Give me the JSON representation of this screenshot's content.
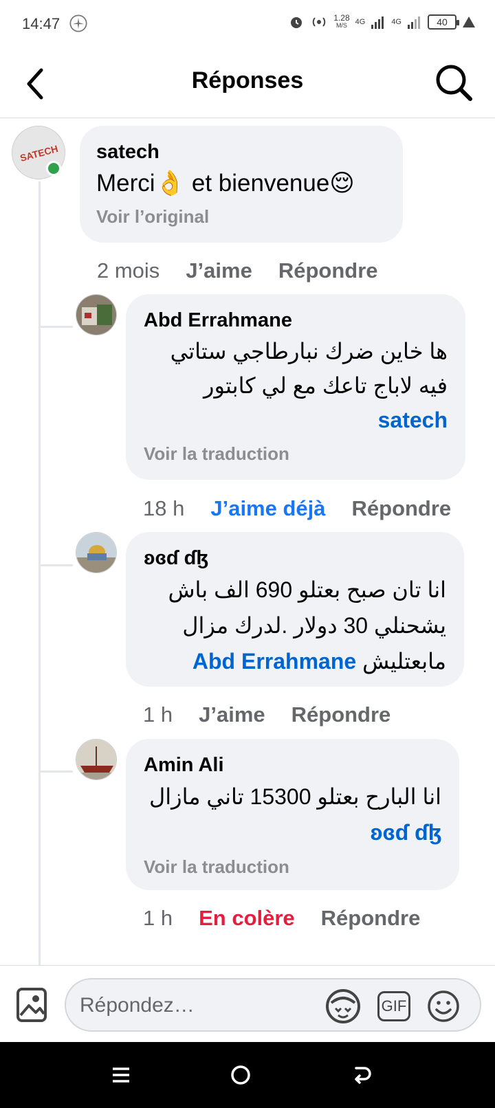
{
  "status_bar": {
    "time": "14:47",
    "speed_value": "1.28",
    "speed_unit": "M/S",
    "net1": "4G",
    "net2": "4G",
    "battery": "40"
  },
  "header": {
    "title": "Réponses"
  },
  "comments": [
    {
      "author": "satech",
      "text": "Merci👌 et bienvenue😌",
      "sub_link": "Voir l’original",
      "time": "2 mois",
      "like_label": "J’aime",
      "reply_label": "Répondre"
    },
    {
      "author": "Abd Errahmane",
      "mention": "satech",
      "text": "ها خاين ضرك نبارطاجي ستاتي فيه لاباج تاعك مع لي كابتور",
      "sub_link": "Voir la traduction",
      "time": "18 h",
      "like_label": "J’aime déjà",
      "reply_label": "Répondre"
    },
    {
      "author": "ʚɞɗ ɗɮ",
      "mention": "Abd Errahmane",
      "text": "انا تان صبح بعتلو 690 الف باش يشحنلي 30 دولار .لدرك مزال مابعتليش",
      "time": "1 h",
      "like_label": "J’aime",
      "reply_label": "Répondre"
    },
    {
      "author": "Amin Ali",
      "mention": "ʚɞɗ ɗɮ",
      "text": "انا البارح بعتلو 15300 تاني مازال",
      "sub_link": "Voir la traduction",
      "time": "1 h",
      "like_label": "En colère",
      "reply_label": "Répondre"
    }
  ],
  "avatar_texts": {
    "satech_logo": "SATECH"
  },
  "composer": {
    "placeholder": "Répondez…",
    "gif_label": "GIF"
  },
  "colors": {
    "accent": "#1877f2",
    "angry": "#e41e3f",
    "online": "#31a24c",
    "bubble": "#f0f2f5"
  }
}
